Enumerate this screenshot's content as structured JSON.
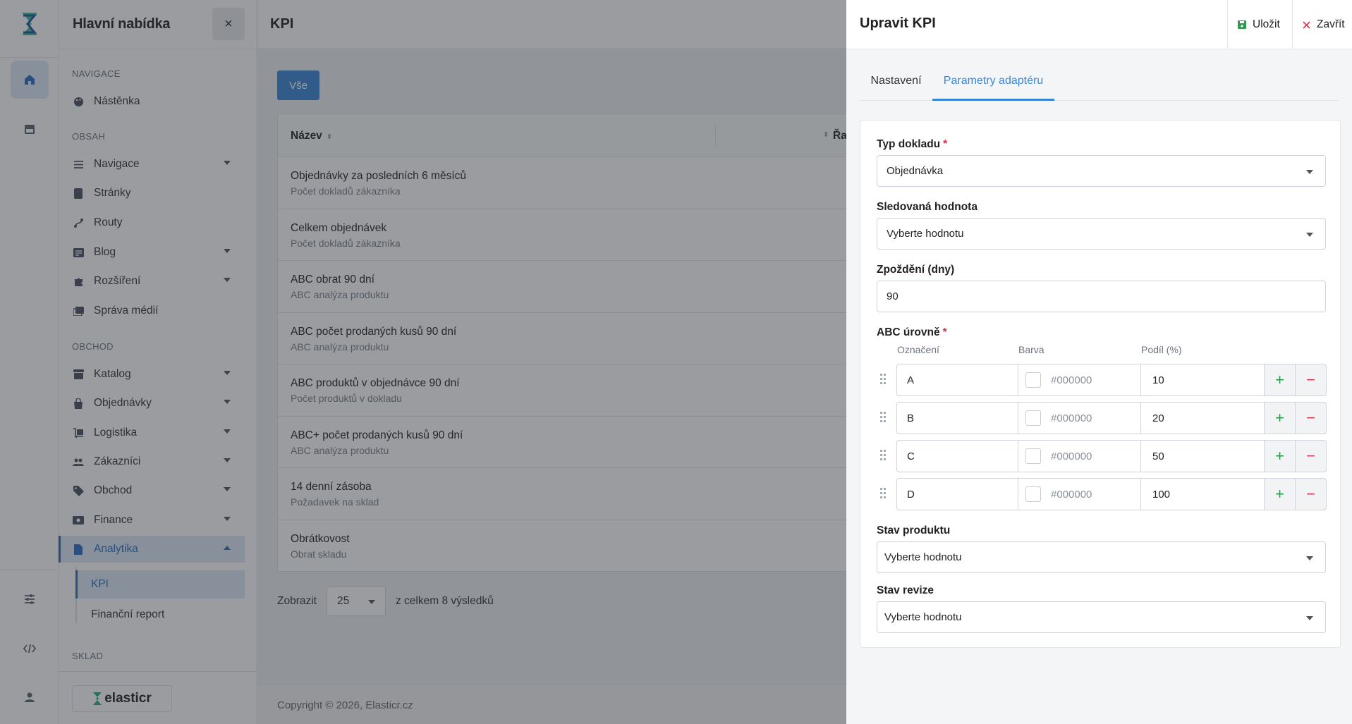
{
  "rail": {
    "items": [
      "home-icon",
      "storefront-icon",
      "sliders-icon",
      "code-icon",
      "user-icon"
    ]
  },
  "sidebar": {
    "title": "Hlavní nabídka",
    "close_label": "×",
    "sections": {
      "nav": "NAVIGACE",
      "content": "OBSAH",
      "commerce": "OBCHOD",
      "warehouse": "SKLAD"
    },
    "items": {
      "dashboard": "Nástěnka",
      "navigation": "Navigace",
      "pages": "Stránky",
      "routes": "Routy",
      "blog": "Blog",
      "extensions": "Rozšíření",
      "media": "Správa médií",
      "catalog": "Katalog",
      "orders": "Objednávky",
      "logistics": "Logistika",
      "customers": "Zákazníci",
      "trade": "Obchod",
      "finance": "Finance",
      "analytics": "Analytika"
    },
    "sub": {
      "kpi": "KPI",
      "finance_report": "Finanční report"
    },
    "brand": "elasticr"
  },
  "main": {
    "title": "KPI",
    "filter_all": "Vše",
    "table": {
      "col_name": "Název",
      "col_second": "Řa",
      "rows": [
        {
          "name": "Objednávky za posledních 6 měsíců",
          "sub": "Počet dokladů zákazníka"
        },
        {
          "name": "Celkem objednávek",
          "sub": "Počet dokladů zákazníka"
        },
        {
          "name": "ABC obrat 90 dní",
          "sub": "ABC analýza produktu"
        },
        {
          "name": "ABC počet prodaných kusů 90 dní",
          "sub": "ABC analýza produktu"
        },
        {
          "name": "ABC produktů v objednávce 90 dní",
          "sub": "Počet produktů v dokladu"
        },
        {
          "name": "ABC+ počet prodaných kusů 90 dní",
          "sub": "ABC analýza produktu"
        },
        {
          "name": "14 denní zásoba",
          "sub": "Požadavek na sklad"
        },
        {
          "name": "Obrátkovost",
          "sub": "Obrat skladu"
        }
      ]
    },
    "pager": {
      "show_label": "Zobrazit",
      "per_page": "25",
      "total_label": "z celkem 8 výsledků"
    },
    "footer": "Copyright © 2026, Elasticr.cz"
  },
  "panel": {
    "title": "Upravit KPI",
    "save_label": "Uložit",
    "close_label": "Zavřít",
    "tabs": [
      "Nastavení",
      "Parametry adaptéru"
    ],
    "active_tab": "Parametry adaptéru",
    "fields": {
      "doc_type_label": "Typ dokladu",
      "doc_type_value": "Objednávka",
      "tracked_label": "Sledovaná hodnota",
      "tracked_value": "Vyberte hodnotu",
      "delay_label": "Zpoždění (dny)",
      "delay_value": "90",
      "abc_label": "ABC úrovně",
      "product_state_label": "Stav produktu",
      "product_state_value": "Vyberte hodnotu",
      "revision_state_label": "Stav revize",
      "revision_state_value": "Vyberte hodnotu",
      "required_mark": "*"
    },
    "abc_columns": [
      "Označení",
      "Barva",
      "Podíl (%)"
    ],
    "abc_rows": [
      {
        "label": "A",
        "color": "#000000",
        "share": "10"
      },
      {
        "label": "B",
        "color": "#000000",
        "share": "20"
      },
      {
        "label": "C",
        "color": "#000000",
        "share": "50"
      },
      {
        "label": "D",
        "color": "#000000",
        "share": "100"
      }
    ],
    "plus": "+",
    "minus": "−",
    "colors": {
      "accent": "#3a86d6",
      "plus": "#2e9b4a",
      "minus": "#d9344a"
    }
  }
}
